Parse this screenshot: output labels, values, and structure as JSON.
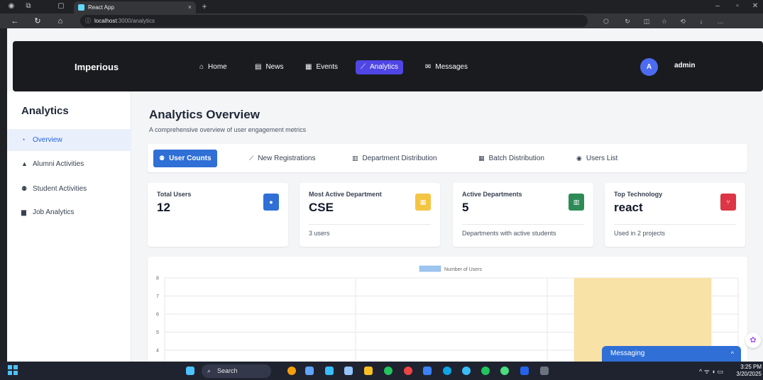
{
  "browser": {
    "tab_title": "React App",
    "url_host": "localhost",
    "url_path": ":3000/analytics",
    "new_tab": "+",
    "close_tab": "×"
  },
  "nav": {
    "brand": "Imperious",
    "links": [
      {
        "label": "Home",
        "icon": "home-icon",
        "glyph": "⌂"
      },
      {
        "label": "News",
        "icon": "newspaper-icon",
        "glyph": "▤"
      },
      {
        "label": "Events",
        "icon": "calendar-icon",
        "glyph": "▦"
      },
      {
        "label": "Analytics",
        "icon": "chart-line-icon",
        "glyph": "⟋"
      },
      {
        "label": "Messages",
        "icon": "envelope-icon",
        "glyph": "✉"
      }
    ],
    "avatar_letter": "A",
    "username": "admin"
  },
  "sidebar": {
    "title": "Analytics",
    "items": [
      {
        "label": "Overview",
        "icon": "pie-chart-icon",
        "glyph": "◔"
      },
      {
        "label": "Alumni Activities",
        "icon": "graduation-cap-icon",
        "glyph": "▲"
      },
      {
        "label": "Student Activities",
        "icon": "users-icon",
        "glyph": "⚉"
      },
      {
        "label": "Job Analytics",
        "icon": "briefcase-icon",
        "glyph": "▆"
      }
    ]
  },
  "main": {
    "title": "Analytics Overview",
    "subtitle": "A comprehensive overview of user engagement metrics",
    "tabs": [
      {
        "label": "User Counts",
        "icon": "users-icon",
        "glyph": "⚉"
      },
      {
        "label": "New Registrations",
        "icon": "chart-line-icon",
        "glyph": "⟋"
      },
      {
        "label": "Department Distribution",
        "icon": "building-icon",
        "glyph": "▥"
      },
      {
        "label": "Batch Distribution",
        "icon": "calendar-icon",
        "glyph": "▦"
      },
      {
        "label": "Users List",
        "icon": "user-circle-icon",
        "glyph": "◉"
      }
    ],
    "cards": [
      {
        "label": "Total Users",
        "value": "12",
        "footer": "",
        "icon": "user-icon",
        "glyph": "●",
        "color": "#2f6fd6"
      },
      {
        "label": "Most Active Department",
        "value": "CSE",
        "footer": "3 users",
        "icon": "building-icon",
        "glyph": "▦",
        "color": "#f4c542"
      },
      {
        "label": "Active Departments",
        "value": "5",
        "footer": "Departments with active students",
        "icon": "university-icon",
        "glyph": "▥",
        "color": "#2e8b57"
      },
      {
        "label": "Top Technology",
        "value": "react",
        "footer": "Used in 2 projects",
        "icon": "code-branch-icon",
        "glyph": "⑂",
        "color": "#dc3545"
      }
    ]
  },
  "chart_data": {
    "type": "bar",
    "legend": [
      "Number of Users"
    ],
    "legend_position": "top",
    "y_ticks": [
      "4",
      "5",
      "6",
      "7",
      "8"
    ],
    "ylim": [
      4,
      8
    ],
    "grid": true,
    "bar_color": "#f9e2a6",
    "legend_color": "#9ec5ef",
    "categories": [
      "",
      "",
      ""
    ],
    "values": [
      null,
      null,
      8
    ]
  },
  "messaging": {
    "label": "Messaging",
    "chevron": "^"
  },
  "taskbar": {
    "search": "Search",
    "time": "3:25 PM",
    "date": "3/20/2025"
  }
}
